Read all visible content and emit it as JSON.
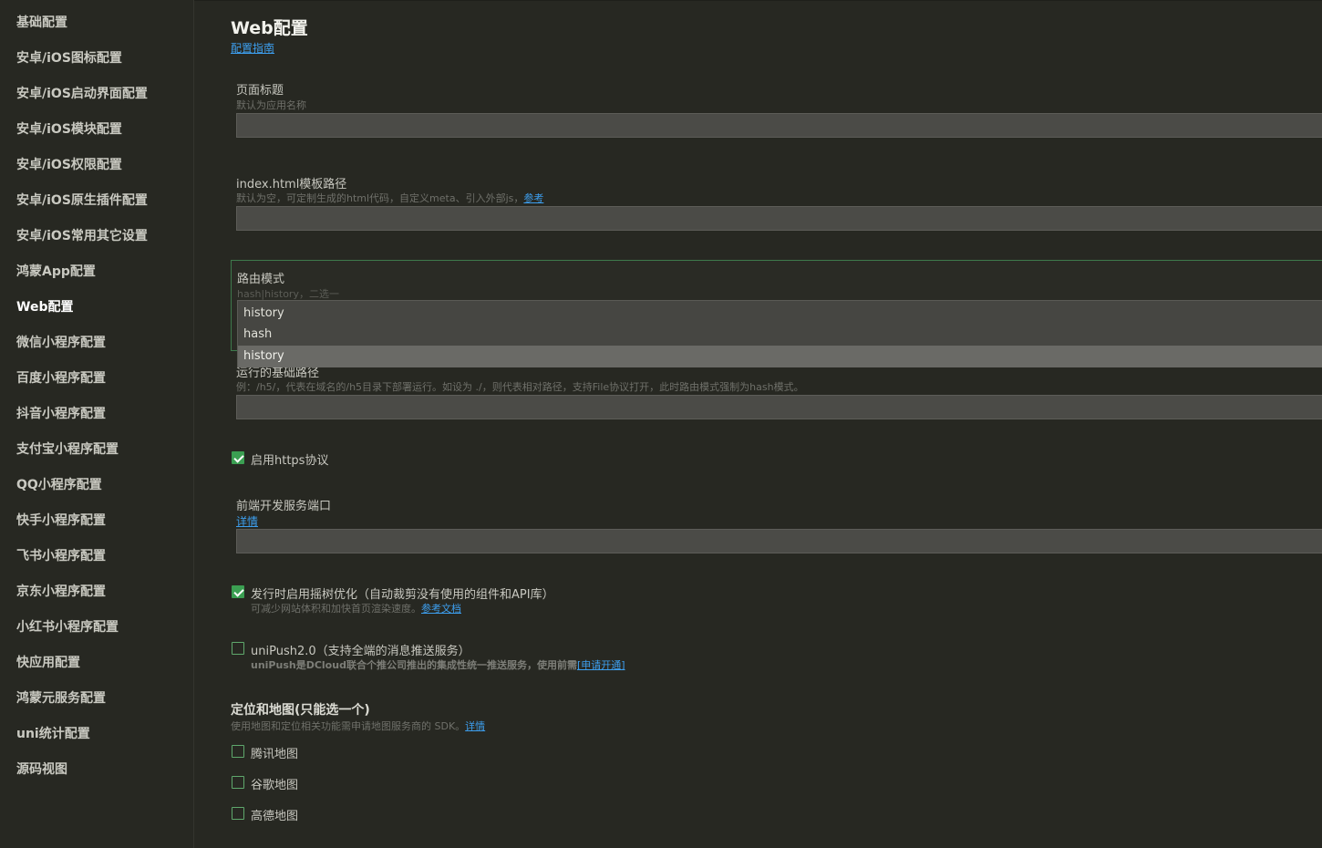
{
  "sidebar": {
    "items": [
      {
        "label": "基础配置"
      },
      {
        "label": "安卓/iOS图标配置"
      },
      {
        "label": "安卓/iOS启动界面配置"
      },
      {
        "label": "安卓/iOS模块配置"
      },
      {
        "label": "安卓/iOS权限配置"
      },
      {
        "label": "安卓/iOS原生插件配置"
      },
      {
        "label": "安卓/iOS常用其它设置"
      },
      {
        "label": "鸿蒙App配置"
      },
      {
        "label": "Web配置"
      },
      {
        "label": "微信小程序配置"
      },
      {
        "label": "百度小程序配置"
      },
      {
        "label": "抖音小程序配置"
      },
      {
        "label": "支付宝小程序配置"
      },
      {
        "label": "QQ小程序配置"
      },
      {
        "label": "快手小程序配置"
      },
      {
        "label": "飞书小程序配置"
      },
      {
        "label": "京东小程序配置"
      },
      {
        "label": "小红书小程序配置"
      },
      {
        "label": "快应用配置"
      },
      {
        "label": "鸿蒙元服务配置"
      },
      {
        "label": "uni统计配置"
      },
      {
        "label": "源码视图"
      }
    ],
    "active": "Web配置"
  },
  "main": {
    "title": "Web配置",
    "guide_link": "配置指南",
    "page_title_field": {
      "label": "页面标题",
      "hint": "默认为应用名称",
      "value": ""
    },
    "template_field": {
      "label": "index.html模板路径",
      "hint": "默认为空，可定制生成的html代码，自定义meta、引入外部js，",
      "hint_link": "参考",
      "value": ""
    },
    "route_mode": {
      "label": "路由模式",
      "hint": "hash|history，二选一",
      "options": [
        "history",
        "hash",
        "history"
      ],
      "selected": "history"
    },
    "base_path": {
      "label": "运行的基础路径",
      "hint": "例：/h5/，代表在域名的/h5目录下部署运行。如设为 ./，则代表相对路径，支持File协议打开，此时路由模式强制为hash模式。",
      "value": ""
    },
    "https": {
      "label": "启用https协议",
      "checked": true
    },
    "dev_port": {
      "label": "前端开发服务端口",
      "link": "详情",
      "value": ""
    },
    "treeshaking": {
      "label": "发行时启用摇树优化（自动裁剪没有使用的组件和API库）",
      "hint": "可减少网站体积和加快首页渲染速度。",
      "hint_link": "参考文档",
      "checked": true
    },
    "unipush": {
      "label": "uniPush2.0（支持全端的消息推送服务）",
      "hint": "uniPush是DCloud联合个推公司推出的集成性统一推送服务，使用前需",
      "hint_link": "[申请开通]",
      "checked": false
    },
    "map_section": {
      "title": "定位和地图(只能选一个)",
      "hint": "使用地图和定位相关功能需申请地图服务商的 SDK。",
      "hint_link": "详情",
      "providers": [
        {
          "label": "腾讯地图",
          "checked": false
        },
        {
          "label": "谷歌地图",
          "checked": false
        },
        {
          "label": "高德地图",
          "checked": false
        }
      ]
    }
  }
}
